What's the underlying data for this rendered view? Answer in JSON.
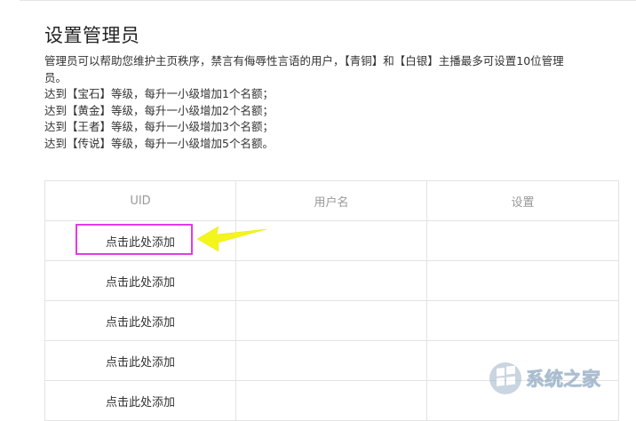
{
  "page": {
    "title": "设置管理员",
    "description_lines": [
      "管理员可以帮助您维护主页秩序，禁言有侮辱性言语的用户，【青铜】和【白银】主播最多可设置10位管理",
      "员。",
      "达到【宝石】等级，每升一小级增加1个名额；",
      "达到【黄金】等级，每升一小级增加2个名额；",
      "达到【王者】等级，每升一小级增加3个名额；",
      "达到【传说】等级，每升一小级增加5个名额。"
    ]
  },
  "table": {
    "headers": [
      "UID",
      "用户名",
      "设置"
    ],
    "rows": [
      {
        "uid": "点击此处添加",
        "username": "",
        "settings": ""
      },
      {
        "uid": "点击此处添加",
        "username": "",
        "settings": ""
      },
      {
        "uid": "点击此处添加",
        "username": "",
        "settings": ""
      },
      {
        "uid": "点击此处添加",
        "username": "",
        "settings": ""
      },
      {
        "uid": "点击此处添加",
        "username": "",
        "settings": ""
      }
    ]
  },
  "annotation": {
    "highlight_color": "#e23be8",
    "arrow_color": "#f5f51e"
  },
  "watermark": {
    "text": "系统之家",
    "icon": "windows-logo-icon"
  }
}
